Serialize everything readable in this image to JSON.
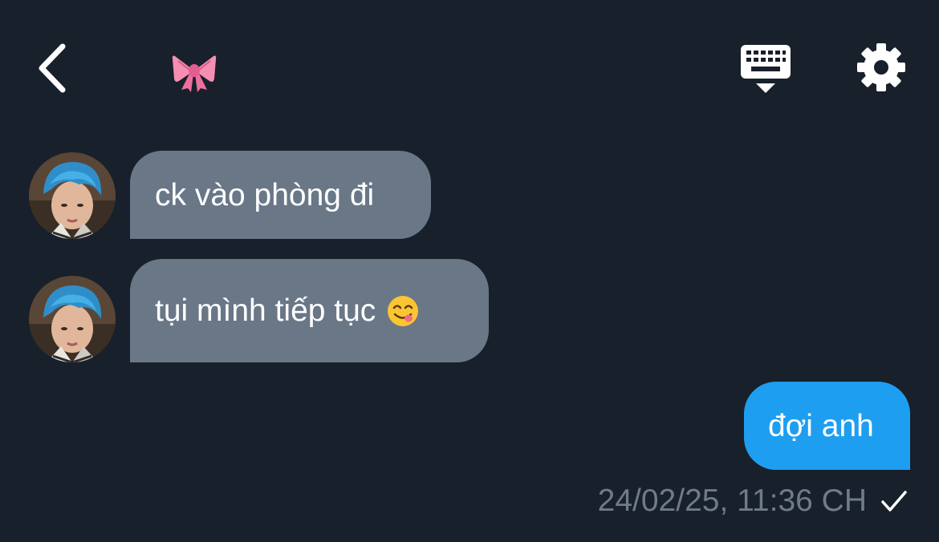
{
  "header": {
    "back_icon": "chevron-left-icon",
    "title_emoji": "ribbon-emoji",
    "keyboard_icon": "keyboard-icon",
    "settings_icon": "gear-icon"
  },
  "messages": [
    {
      "direction": "incoming",
      "text": "ck vào phòng đi"
    },
    {
      "direction": "incoming",
      "text": "tụi mình tiếp tục",
      "emoji": "savoring-face-emoji"
    },
    {
      "direction": "outgoing",
      "text": "đợi anh"
    }
  ],
  "status": {
    "timestamp": "24/02/25, 11:36 CH",
    "read_icon": "checkmark-icon"
  },
  "colors": {
    "background": "#18202b",
    "incoming_bubble": "#697787",
    "outgoing_bubble": "#1e9ef0",
    "timestamp": "#6f7b88"
  }
}
